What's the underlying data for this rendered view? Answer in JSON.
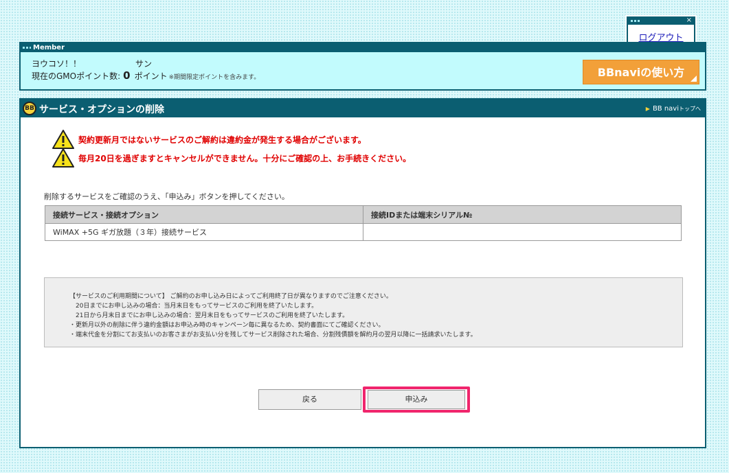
{
  "logout": {
    "label": "ログアウト",
    "close": "×"
  },
  "member": {
    "bar_label": "Member",
    "greeting": "ヨウコソ！！",
    "name": "サン",
    "points_label": "現在のGMOポイント数:",
    "points_value": "0",
    "points_unit": "ポイント",
    "points_note": "※期間限定ポイントを含みます。",
    "guide_button": "BBnaviの使い方"
  },
  "main": {
    "logo": "BB",
    "title": "サービス・オプションの削除",
    "top_link": "BB navi",
    "top_link_suffix": "トップへ",
    "warnings": [
      "契約更新月ではないサービスのご解約は違約金が発生する場合がございます。",
      "毎月20日を過ぎますとキャンセルができません。十分にご確認の上、お手続きください。"
    ],
    "instruction": "削除するサービスをご確認のうえ、「申込み」ボタンを押してください。",
    "table": {
      "headers": [
        "接続サービス・接続オプション",
        "接続IDまたは端末シリアル№"
      ],
      "rows": [
        [
          "WiMAX +5G ギガ放題（３年）接続サービス",
          ""
        ]
      ]
    },
    "notice": [
      "【サービスのご利用期間について】 ご解約のお申し込み日によってご利用終了日が異なりますのでご注意ください。",
      "　20日までにお申し込みの場合：当月末日をもってサービスのご利用を終了いたします。",
      "　21日から月末日までにお申し込みの場合：翌月末日をもってサービスのご利用を終了いたします。",
      "・更新月以外の削除に伴う違約金額はお申込み時のキャンペーン毎に異なるため、契約書面にてご確認ください。",
      "・端末代金を分割にてお支払いのお客さまがお支払い分を残してサービス削除された場合、分割残債額を解約月の翌月以降に一括請求いたします。"
    ],
    "back_button": "戻る",
    "apply_button": "申込み"
  },
  "colors": {
    "header": "#0b5e71",
    "warning": "#e00000",
    "highlight": "#f0256c",
    "guide": "#f2a039"
  }
}
